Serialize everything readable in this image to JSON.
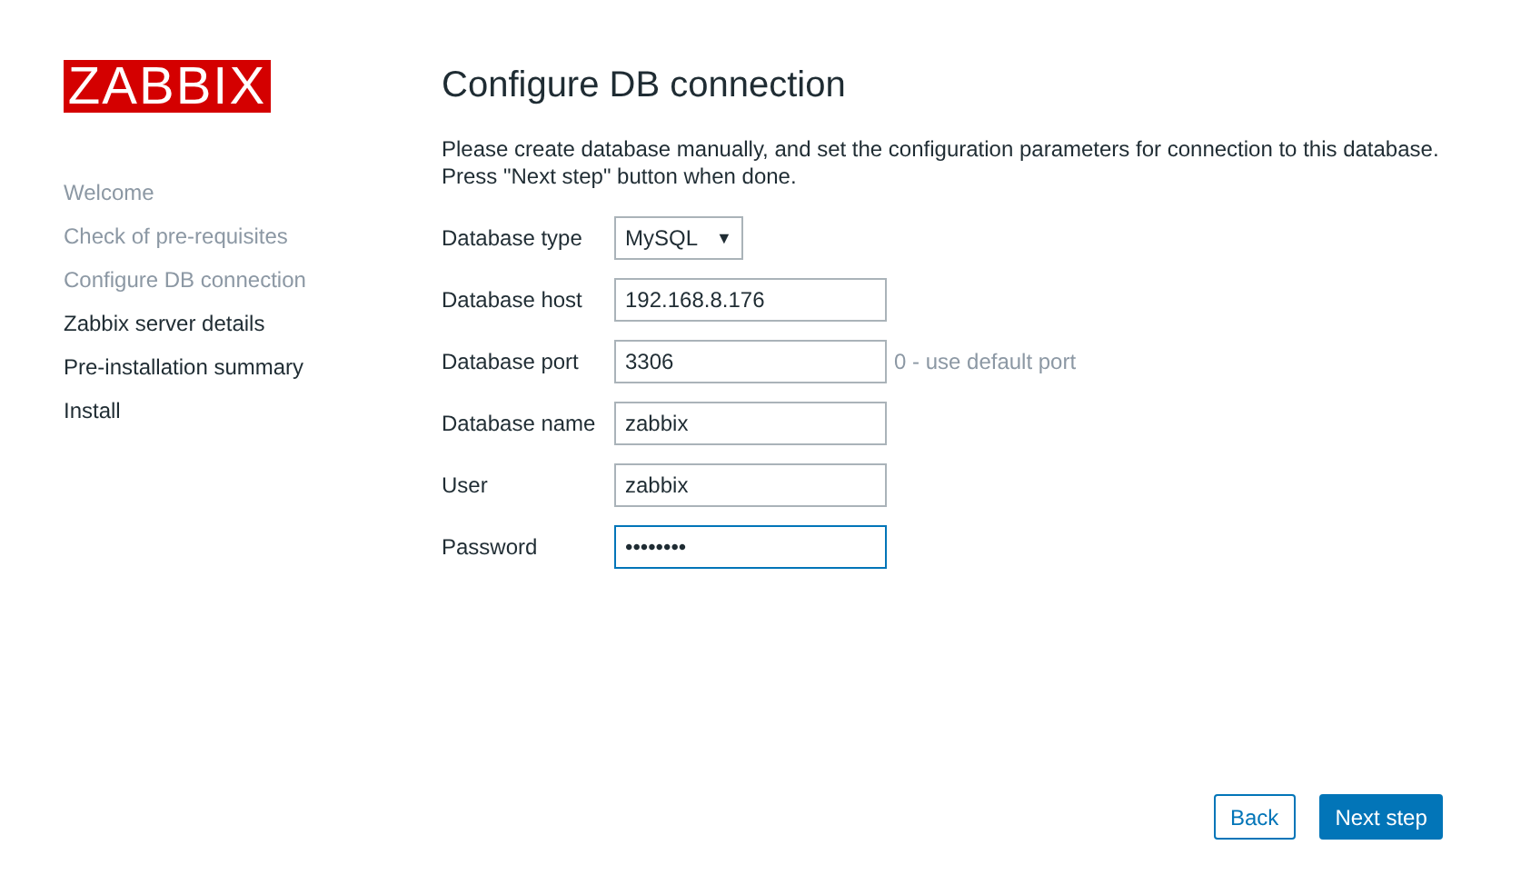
{
  "logo": "ZABBIX",
  "steps": [
    {
      "label": "Welcome",
      "done": true
    },
    {
      "label": "Check of pre-requisites",
      "done": true
    },
    {
      "label": "Configure DB connection",
      "done": true
    },
    {
      "label": "Zabbix server details",
      "done": false
    },
    {
      "label": "Pre-installation summary",
      "done": false
    },
    {
      "label": "Install",
      "done": false
    }
  ],
  "title": "Configure DB connection",
  "intro": [
    "Please create database manually, and set the configuration parameters for connection to this database.",
    "Press \"Next step\" button when done."
  ],
  "fields": [
    {
      "kind": "select",
      "label": "Database type",
      "value": "MySQL",
      "caret": "▼"
    },
    {
      "kind": "text",
      "label": "Database host",
      "value": "192.168.8.176",
      "focused": false
    },
    {
      "kind": "text",
      "label": "Database port",
      "value": "3306",
      "hint": "0 - use default port",
      "focused": false
    },
    {
      "kind": "text",
      "label": "Database name",
      "value": "zabbix",
      "focused": false
    },
    {
      "kind": "text",
      "label": "User",
      "value": "zabbix",
      "focused": false
    },
    {
      "kind": "text",
      "label": "Password",
      "value": "••••••••",
      "focused": true
    }
  ],
  "buttons": [
    {
      "label": "Back",
      "primary": false
    },
    {
      "label": "Next step",
      "primary": true
    }
  ]
}
